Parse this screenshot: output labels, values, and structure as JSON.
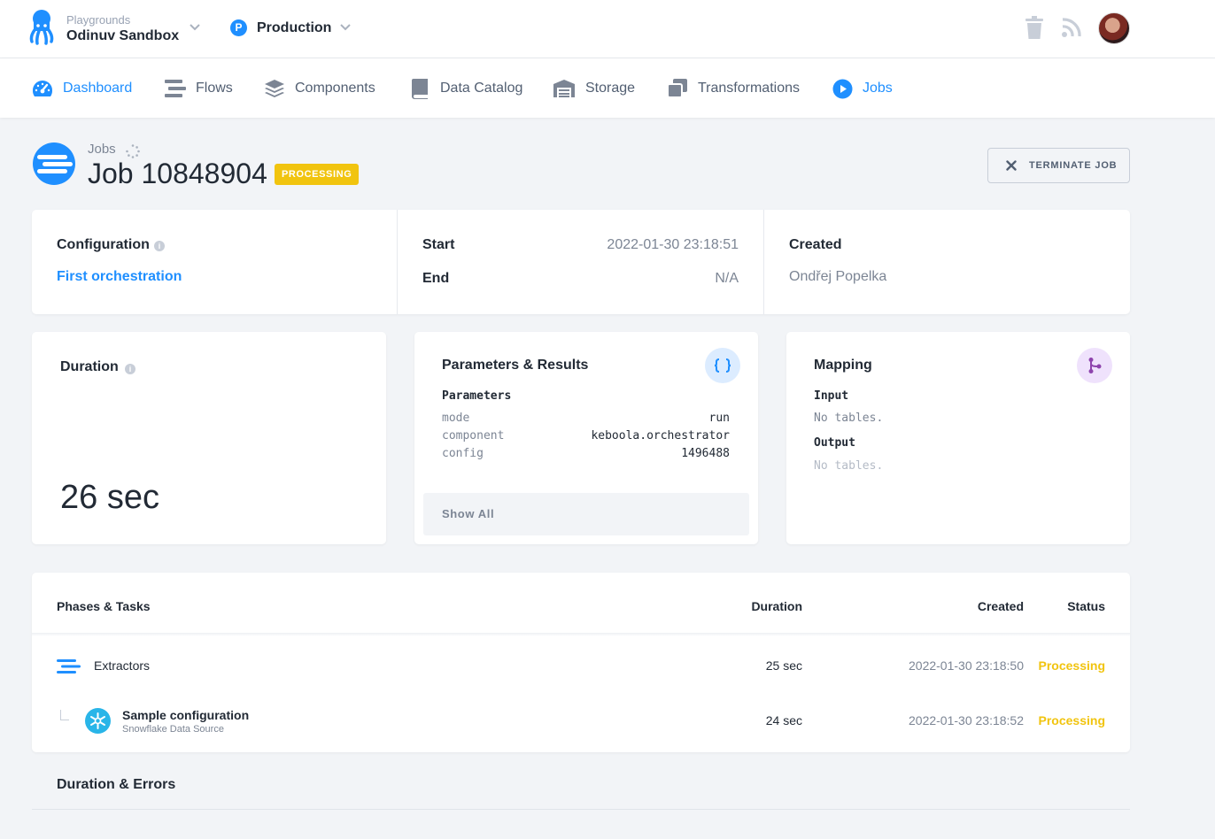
{
  "topbar": {
    "project_label": "Playgrounds",
    "project_name": "Odinuv Sandbox",
    "branch_badge": "P",
    "branch_name": "Production"
  },
  "nav": {
    "items": [
      {
        "label": "Dashboard",
        "icon": "dashboard-icon",
        "active": true
      },
      {
        "label": "Flows",
        "icon": "flows-icon"
      },
      {
        "label": "Components",
        "icon": "components-icon"
      },
      {
        "label": "Data Catalog",
        "icon": "book-icon"
      },
      {
        "label": "Storage",
        "icon": "storage-icon"
      },
      {
        "label": "Transformations",
        "icon": "transformations-icon"
      },
      {
        "label": "Jobs",
        "icon": "play-circle-icon",
        "active": true
      }
    ]
  },
  "header": {
    "breadcrumb": "Jobs",
    "title": "Job 10848904",
    "status": "PROCESSING",
    "terminate_label": "TERMINATE JOB"
  },
  "info": {
    "configuration_label": "Configuration",
    "configuration_value": "First orchestration",
    "start_label": "Start",
    "start_value": "2022-01-30 23:18:51",
    "end_label": "End",
    "end_value": "N/A",
    "created_label": "Created",
    "created_value": "Ondřej Popelka"
  },
  "duration": {
    "label": "Duration",
    "value": "26 sec"
  },
  "parameters": {
    "title": "Parameters & Results",
    "subtitle": "Parameters",
    "rows": [
      {
        "key": "mode",
        "value": "run"
      },
      {
        "key": "component",
        "value": "keboola.orchestrator"
      },
      {
        "key": "config",
        "value": "1496488"
      }
    ],
    "show_all": "Show All"
  },
  "mapping": {
    "title": "Mapping",
    "input_label": "Input",
    "input_value": "No tables.",
    "output_label": "Output",
    "output_value": "No tables."
  },
  "phases": {
    "headers": {
      "name": "Phases & Tasks",
      "duration": "Duration",
      "created": "Created",
      "status": "Status"
    },
    "rows": [
      {
        "name": "Extractors",
        "subtitle": "",
        "duration": "25 sec",
        "created": "2022-01-30 23:18:50",
        "status": "Processing"
      },
      {
        "name": "Sample configuration",
        "subtitle": "Snowflake Data Source",
        "duration": "24 sec",
        "created": "2022-01-30 23:18:52",
        "status": "Processing"
      }
    ]
  },
  "section": {
    "duration_errors": "Duration & Errors"
  },
  "colors": {
    "accent": "#1f8fff",
    "processing": "#f1c40f",
    "text": "#222a35",
    "muted": "#7c8594"
  }
}
